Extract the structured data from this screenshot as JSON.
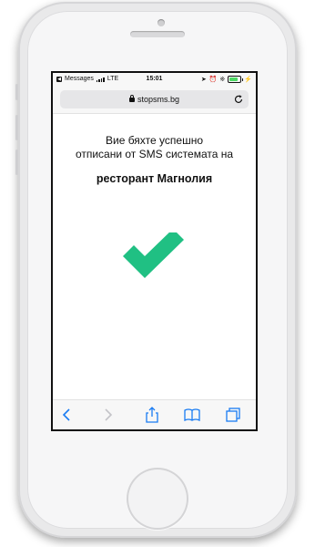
{
  "status_bar": {
    "back_app": "Messages",
    "carrier": "LTE",
    "time": "15:01"
  },
  "browser": {
    "url": "stopsms.bg"
  },
  "page": {
    "line1": "Вие бяхте успешно",
    "line2": "отписани от SMS системата на",
    "restaurant": "ресторант Магнолия"
  },
  "colors": {
    "check": "#20c083",
    "ios_blue": "#1a7cf3"
  },
  "icons": {
    "success": "check-icon",
    "toolbar": [
      "back-icon",
      "forward-icon",
      "share-icon",
      "bookmarks-icon",
      "tabs-icon"
    ]
  }
}
